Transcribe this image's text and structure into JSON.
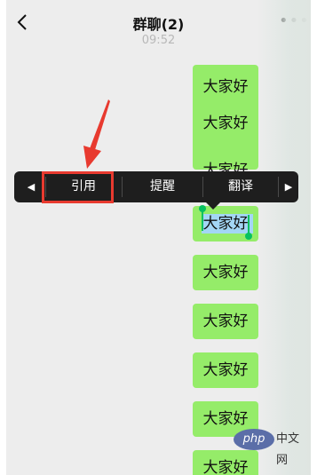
{
  "header": {
    "title": "群聊(2)",
    "more_label": "•••",
    "timestamp": "09:52"
  },
  "messages": [
    {
      "lines": [
        "大家好",
        "大家好",
        "大家好"
      ]
    },
    {
      "text": "大家好"
    },
    {
      "text": "大家好"
    },
    {
      "text": "大家好"
    },
    {
      "text": "大家好"
    },
    {
      "text": "大家好"
    },
    {
      "text": "大家好"
    }
  ],
  "context_menu": {
    "prev_label": "◀",
    "items": [
      "引用",
      "提醒",
      "翻译"
    ],
    "next_label": "▶"
  },
  "watermark": {
    "logo_text": "php",
    "site_text": "中文网"
  },
  "colors": {
    "bubble": "#95ec69",
    "menu_bg": "#1e1e1e",
    "highlight": "#e83a2f",
    "selection_handle": "#07c160"
  }
}
